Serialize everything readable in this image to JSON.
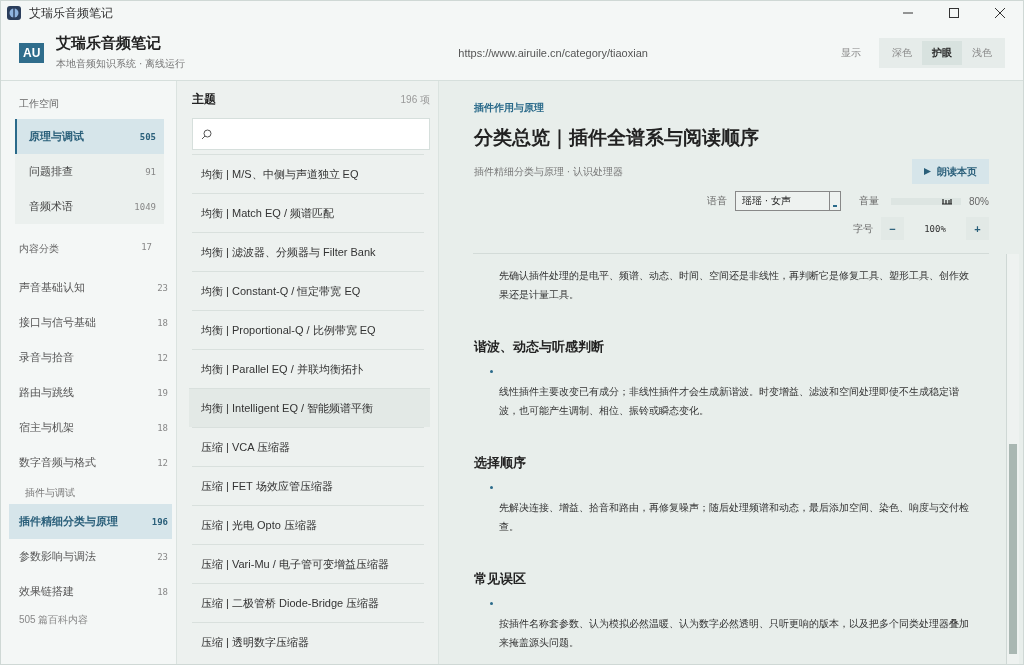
{
  "window": {
    "title": "艾瑞乐音频笔记"
  },
  "header": {
    "logo": "AU",
    "app_name": "艾瑞乐音频笔记",
    "subtitle": "本地音频知识系统 · 离线运行",
    "url": "https://www.airuile.cn/category/tiaoxian",
    "display_label": "显示",
    "themes": [
      {
        "label": "深色",
        "selected": false
      },
      {
        "label": "护眼",
        "selected": true
      },
      {
        "label": "浅色",
        "selected": false
      }
    ]
  },
  "sidebar": {
    "workspace_label": "工作空间",
    "workspace_items": [
      {
        "label": "原理与调试",
        "count": "505",
        "selected": true
      },
      {
        "label": "问题排查",
        "count": "91",
        "selected": false
      },
      {
        "label": "音频术语",
        "count": "1049",
        "selected": false
      }
    ],
    "category_label": "内容分类",
    "category_count": "17",
    "categories": [
      {
        "kind": "item",
        "label": "声音基础认知",
        "count": "23",
        "selected": false
      },
      {
        "kind": "item",
        "label": "接口与信号基础",
        "count": "18",
        "selected": false
      },
      {
        "kind": "item",
        "label": "录音与拾音",
        "count": "12",
        "selected": false
      },
      {
        "kind": "item",
        "label": "路由与跳线",
        "count": "19",
        "selected": false
      },
      {
        "kind": "item",
        "label": "宿主与机架",
        "count": "18",
        "selected": false
      },
      {
        "kind": "item",
        "label": "数字音频与格式",
        "count": "12",
        "selected": false
      },
      {
        "kind": "group",
        "label": "插件与调试"
      },
      {
        "kind": "item",
        "label": "插件精细分类与原理",
        "count": "196",
        "selected": true
      },
      {
        "kind": "item",
        "label": "参数影响与调法",
        "count": "23",
        "selected": false
      },
      {
        "kind": "item",
        "label": "效果链搭建",
        "count": "18",
        "selected": false
      }
    ],
    "footer": "505 篇百科内容"
  },
  "topics": {
    "title": "主题",
    "count": "196 项",
    "items": [
      {
        "label": "均衡 | M/S、中侧与声道独立 EQ",
        "selected": false
      },
      {
        "label": "均衡 | Match EQ / 频谱匹配",
        "selected": false
      },
      {
        "label": "均衡 | 滤波器、分频器与 Filter Bank",
        "selected": false
      },
      {
        "label": "均衡 | Constant-Q / 恒定带宽 EQ",
        "selected": false
      },
      {
        "label": "均衡 | Proportional-Q / 比例带宽 EQ",
        "selected": false
      },
      {
        "label": "均衡 | Parallel EQ / 并联均衡拓扑",
        "selected": false
      },
      {
        "label": "均衡 | Intelligent EQ / 智能频谱平衡",
        "selected": true
      },
      {
        "label": "压缩 | VCA 压缩器",
        "selected": false
      },
      {
        "label": "压缩 | FET 场效应管压缩器",
        "selected": false
      },
      {
        "label": "压缩 | 光电 Opto 压缩器",
        "selected": false
      },
      {
        "label": "压缩 | Vari-Mu / 电子管可变增益压缩器",
        "selected": false
      },
      {
        "label": "压缩 | 二极管桥 Diode-Bridge 压缩器",
        "selected": false
      },
      {
        "label": "压缩 | 透明数字压缩器",
        "selected": false
      }
    ]
  },
  "article": {
    "category": "插件作用与原理",
    "title": "分类总览｜插件全谱系与阅读顺序",
    "meta": "插件精细分类与原理 · 认识处理器",
    "read_button": "朗读本页",
    "voice_label": "语音",
    "voice": "瑶瑶 · 女声",
    "volume_label": "音量",
    "volume": {
      "level": 0.8
    },
    "volume_reading": "80%",
    "font_label": "字号",
    "font_minus": "−",
    "font_size": "100%",
    "font_plus": "+",
    "intro": "先确认插件处理的是电平、频谱、动态、时间、空间还是非线性，再判断它是修复工具、塑形工具、创作效果还是计量工具。",
    "sections": [
      {
        "heading": "谐波、动态与听感判断",
        "bullets": [
          "线性插件主要改变已有成分；非线性插件才会生成新谐波。时变增益、滤波和空间处理即使不生成稳定谐波，也可能产生调制、相位、振铃或瞬态变化。"
        ]
      },
      {
        "heading": "选择顺序",
        "bullets": [
          "先解决连接、增益、拾音和路由，再修复噪声；随后处理频谱和动态，最后添加空间、染色、响度与交付检查。"
        ]
      },
      {
        "heading": "常见误区",
        "bullets": [
          "按插件名称套参数、认为模拟必然温暖、认为数字必然透明、只听更响的版本，以及把多个同类处理器叠加来掩盖源头问题。"
        ]
      }
    ]
  }
}
